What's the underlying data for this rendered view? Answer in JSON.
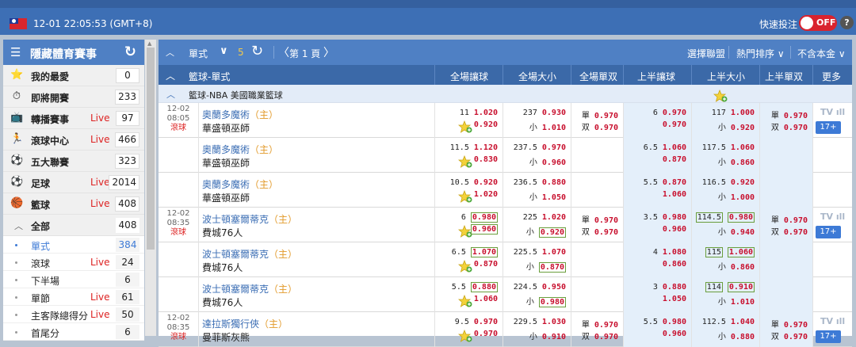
{
  "topbar": {
    "datetime": "12-01 22:05:53 (GMT+8)",
    "quick_bet_label": "快速投注",
    "toggle_state": "OFF",
    "help": "?"
  },
  "sidebar": {
    "title": "隱藏體育賽事",
    "items": [
      {
        "label": "我的最愛",
        "live": "",
        "count": "0",
        "icon": "star-icon"
      },
      {
        "label": "即將開賽",
        "live": "",
        "count": "233",
        "icon": "stopwatch-icon"
      },
      {
        "label": "轉播賽事",
        "live": "Live",
        "count": "97",
        "icon": "tv-icon"
      },
      {
        "label": "滾球中心",
        "live": "Live",
        "count": "466",
        "icon": "runner-icon"
      },
      {
        "label": "五大聯賽",
        "live": "",
        "count": "323",
        "icon": "soccer-ball-icon"
      },
      {
        "label": "足球",
        "live": "Live",
        "count": "2014",
        "icon": "soccer-icon"
      },
      {
        "label": "籃球",
        "live": "Live",
        "count": "408",
        "icon": "basketball-icon"
      }
    ],
    "all": {
      "label": "全部",
      "count": "408"
    },
    "subitems": [
      {
        "label": "單式",
        "live": "",
        "count": "384",
        "active": true
      },
      {
        "label": "滾球",
        "live": "Live",
        "count": "24"
      },
      {
        "label": "下半場",
        "live": "",
        "count": "6"
      },
      {
        "label": "單節",
        "live": "Live",
        "count": "61"
      },
      {
        "label": "主客隊總得分",
        "live": "Live",
        "count": "50"
      },
      {
        "label": "首尾分",
        "live": "",
        "count": "6"
      }
    ]
  },
  "toolbar": {
    "mode": "單式",
    "count": "5",
    "prev": "〈",
    "page": "第 1 頁",
    "next": "〉",
    "select_league": "選擇聯盟",
    "hot_sort": "熱門排序",
    "stake": "不含本金"
  },
  "table_header": {
    "sport": "籃球-單式",
    "cols": [
      "全場讓球",
      "全場大小",
      "全場單双",
      "上半讓球",
      "上半大小",
      "上半單双",
      "更多"
    ]
  },
  "league": {
    "name": "籃球-NBA 美國職業籃球"
  },
  "rows": [
    {
      "date": "12-02",
      "time": "08:05",
      "status": "滾球",
      "home": "奧蘭多魔術",
      "home_tag": "（主）",
      "away": "華盛頓巫師",
      "c1": [
        "11",
        "1.020",
        "",
        "0.920"
      ],
      "c2": [
        "237",
        "0.930",
        "小",
        "1.010"
      ],
      "c3": [
        "單",
        "0.970",
        "双",
        "0.970"
      ],
      "c4": [
        "6",
        "0.970",
        "",
        "0.970"
      ],
      "c5": [
        "117",
        "1.000",
        "小",
        "0.920"
      ],
      "c6": [
        "單",
        "0.970",
        "双",
        "0.970"
      ],
      "tv": "TV",
      "more": "17+"
    },
    {
      "date": "",
      "time": "",
      "status": "",
      "home": "奧蘭多魔術",
      "home_tag": "（主）",
      "away": "華盛頓巫師",
      "c1": [
        "11.5",
        "1.120",
        "",
        "0.830"
      ],
      "c2": [
        "237.5",
        "0.970",
        "小",
        "0.960"
      ],
      "c3": [
        "",
        "",
        "",
        ""
      ],
      "c4": [
        "6.5",
        "1.060",
        "",
        "0.870"
      ],
      "c5": [
        "117.5",
        "1.060",
        "小",
        "0.860"
      ],
      "c6": [
        "",
        "",
        "",
        ""
      ],
      "tv": "",
      "more": ""
    },
    {
      "date": "",
      "time": "",
      "status": "",
      "home": "奧蘭多魔術",
      "home_tag": "（主）",
      "away": "華盛頓巫師",
      "c1": [
        "10.5",
        "0.920",
        "",
        "1.020"
      ],
      "c2": [
        "236.5",
        "0.880",
        "小",
        "1.050"
      ],
      "c3": [
        "",
        "",
        "",
        ""
      ],
      "c4": [
        "5.5",
        "0.870",
        "",
        "1.060"
      ],
      "c5": [
        "116.5",
        "0.920",
        "小",
        "1.000"
      ],
      "c6": [
        "",
        "",
        "",
        ""
      ],
      "tv": "",
      "more": ""
    },
    {
      "date": "12-02",
      "time": "08:35",
      "status": "滾球",
      "home": "波士頓塞爾蒂克",
      "home_tag": "（主）",
      "away": "費城76人",
      "c1": [
        "6",
        "0.980",
        "",
        "0.960"
      ],
      "c2": [
        "225",
        "1.020",
        "小",
        "0.920"
      ],
      "c3": [
        "單",
        "0.970",
        "双",
        "0.970"
      ],
      "c4": [
        "3.5",
        "0.980",
        "",
        "0.960"
      ],
      "c5": [
        "114.5",
        "0.980",
        "小",
        "0.940"
      ],
      "c6": [
        "單",
        "0.970",
        "双",
        "0.970"
      ],
      "tv": "TV",
      "more": "17+"
    },
    {
      "date": "",
      "time": "",
      "status": "",
      "home": "波士頓塞爾蒂克",
      "home_tag": "（主）",
      "away": "費城76人",
      "c1": [
        "6.5",
        "1.070",
        "",
        "0.870"
      ],
      "c2": [
        "225.5",
        "1.070",
        "小",
        "0.870"
      ],
      "c3": [
        "",
        "",
        "",
        ""
      ],
      "c4": [
        "4",
        "1.080",
        "",
        "0.860"
      ],
      "c5": [
        "115",
        "1.060",
        "小",
        "0.860"
      ],
      "c6": [
        "",
        "",
        "",
        ""
      ],
      "tv": "",
      "more": ""
    },
    {
      "date": "",
      "time": "",
      "status": "",
      "home": "波士頓塞爾蒂克",
      "home_tag": "（主）",
      "away": "費城76人",
      "c1": [
        "5.5",
        "0.880",
        "",
        "1.060"
      ],
      "c2": [
        "224.5",
        "0.950",
        "小",
        "0.980"
      ],
      "c3": [
        "",
        "",
        "",
        ""
      ],
      "c4": [
        "3",
        "0.880",
        "",
        "1.050"
      ],
      "c5": [
        "114",
        "0.910",
        "小",
        "1.010"
      ],
      "c6": [
        "",
        "",
        "",
        ""
      ],
      "tv": "",
      "more": ""
    },
    {
      "date": "12-02",
      "time": "08:35",
      "status": "滾球",
      "home": "達拉斯獨行俠",
      "home_tag": "（主）",
      "away": "曼菲斯灰熊",
      "c1": [
        "9.5",
        "0.970",
        "",
        "0.970"
      ],
      "c2": [
        "229.5",
        "1.030",
        "小",
        "0.910"
      ],
      "c3": [
        "單",
        "0.970",
        "双",
        "0.970"
      ],
      "c4": [
        "5.5",
        "0.980",
        "",
        "0.960"
      ],
      "c5": [
        "112.5",
        "1.040",
        "小",
        "0.880"
      ],
      "c6": [
        "單",
        "0.970",
        "双",
        "0.970"
      ],
      "tv": "TV",
      "more": "17+"
    }
  ]
}
